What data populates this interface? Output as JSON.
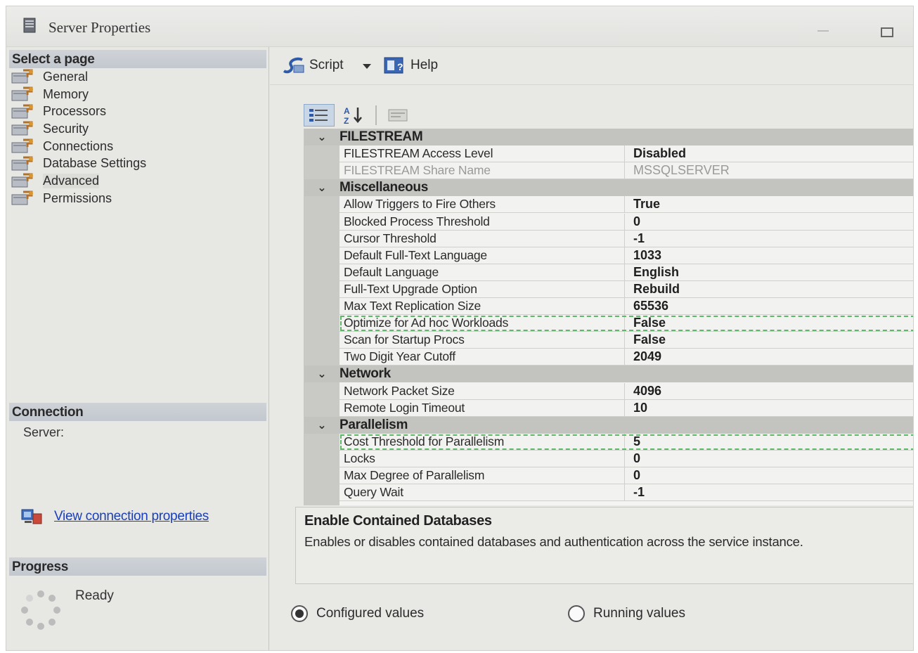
{
  "window": {
    "title": "Server Properties"
  },
  "left_panel": {
    "select_page_header": "Select a page",
    "pages": [
      {
        "label": "General"
      },
      {
        "label": "Memory"
      },
      {
        "label": "Processors"
      },
      {
        "label": "Security"
      },
      {
        "label": "Connections"
      },
      {
        "label": "Database Settings"
      },
      {
        "label": "Advanced",
        "active": true
      },
      {
        "label": "Permissions"
      }
    ],
    "connection_header": "Connection",
    "server_label": "Server:",
    "view_connection_link": "View connection properties",
    "progress_header": "Progress",
    "progress_status": "Ready"
  },
  "toolbar": {
    "script_label": "Script",
    "help_label": "Help"
  },
  "property_grid": {
    "categories": [
      {
        "name": "FILESTREAM",
        "toggle": "⌄",
        "properties": [
          {
            "name": "FILESTREAM Access Level",
            "value": "Disabled"
          },
          {
            "name": "FILESTREAM Share Name",
            "value": "MSSQLSERVER",
            "disabled": true
          }
        ]
      },
      {
        "name": "Miscellaneous",
        "toggle": "⌄",
        "properties": [
          {
            "name": "Allow Triggers to Fire Others",
            "value": "True"
          },
          {
            "name": "Blocked Process Threshold",
            "value": "0"
          },
          {
            "name": "Cursor Threshold",
            "value": "-1"
          },
          {
            "name": "Default Full-Text Language",
            "value": "1033"
          },
          {
            "name": "Default Language",
            "value": "English"
          },
          {
            "name": "Full-Text Upgrade Option",
            "value": "Rebuild"
          },
          {
            "name": "Max Text Replication Size",
            "value": "65536"
          },
          {
            "name": "Optimize for Ad hoc Workloads",
            "value": "False",
            "highlight": true
          },
          {
            "name": "Scan for Startup Procs",
            "value": "False"
          },
          {
            "name": "Two Digit Year Cutoff",
            "value": "2049"
          }
        ]
      },
      {
        "name": "Network",
        "toggle": "⌄",
        "properties": [
          {
            "name": "Network Packet Size",
            "value": "4096"
          },
          {
            "name": "Remote Login Timeout",
            "value": "10"
          }
        ]
      },
      {
        "name": "Parallelism",
        "toggle": "⌄",
        "properties": [
          {
            "name": "Cost Threshold for Parallelism",
            "value": "5",
            "highlight": true
          },
          {
            "name": "Locks",
            "value": "0"
          },
          {
            "name": "Max Degree of Parallelism",
            "value": "0"
          },
          {
            "name": "Query Wait",
            "value": "-1"
          }
        ]
      }
    ]
  },
  "description": {
    "title": "Enable Contained Databases",
    "text": "Enables or disables contained databases and authentication across the service instance."
  },
  "radios": {
    "configured_label": "Configured values",
    "running_label": "Running values",
    "selected": "configured"
  }
}
